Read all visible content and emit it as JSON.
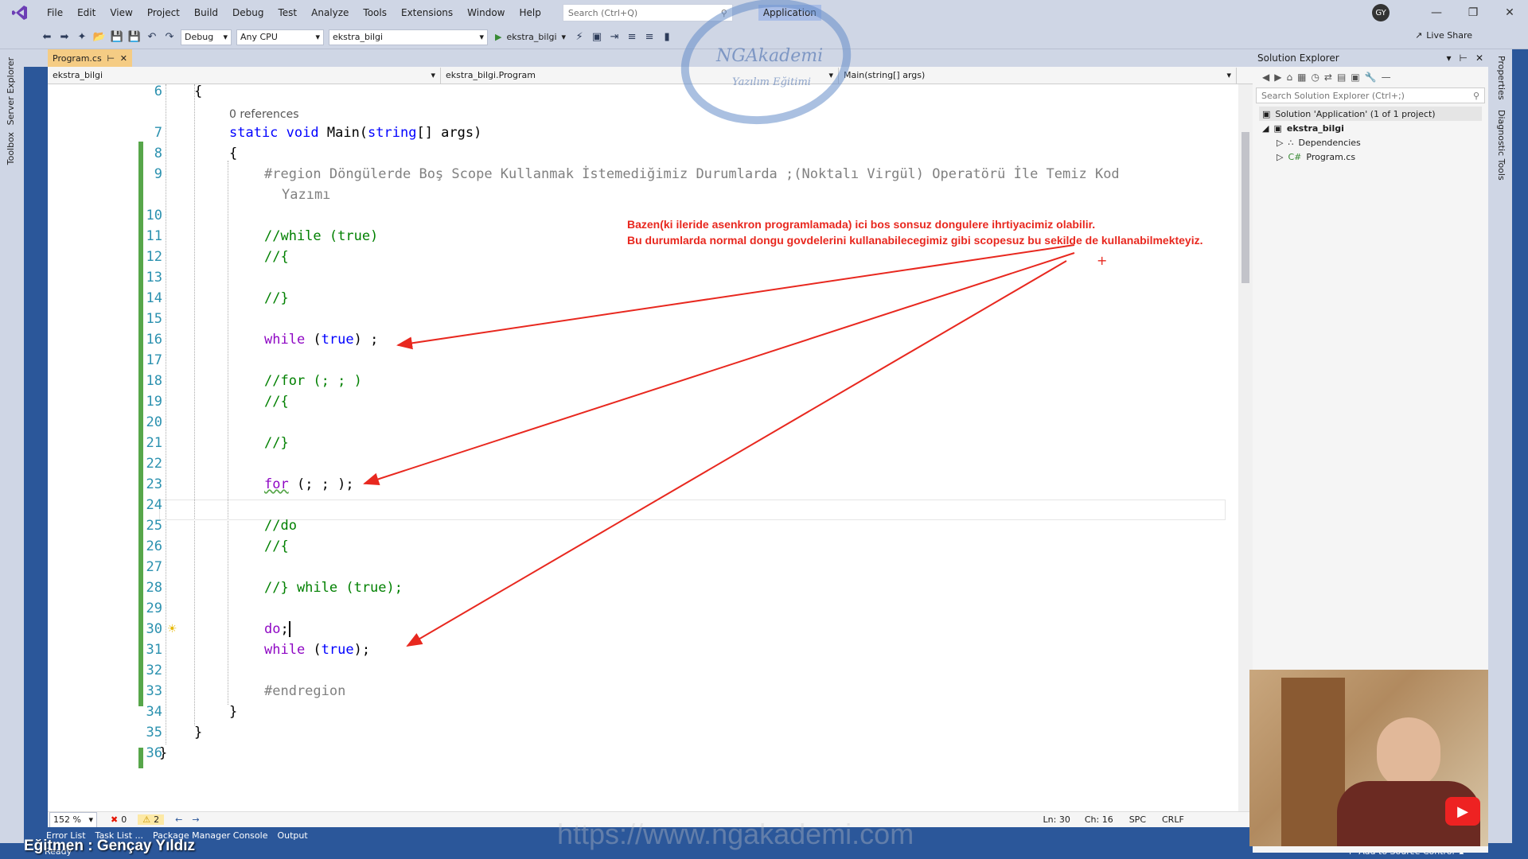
{
  "menu": {
    "items": [
      "File",
      "Edit",
      "View",
      "Project",
      "Build",
      "Debug",
      "Test",
      "Analyze",
      "Tools",
      "Extensions",
      "Window",
      "Help"
    ],
    "search_placeholder": "Search (Ctrl+Q)",
    "app_title": "Application",
    "avatar_initials": "GY"
  },
  "toolbar": {
    "config": "Debug",
    "platform": "Any CPU",
    "project": "ekstra_bilgi",
    "run_label": "ekstra_bilgi",
    "live_share": "Live Share"
  },
  "left_rail": {
    "server_explorer": "Server Explorer",
    "toolbox": "Toolbox"
  },
  "right_rail": {
    "properties": "Properties",
    "diagnostic": "Diagnostic Tools"
  },
  "doc_tab": {
    "name": "Program.cs"
  },
  "navbar": {
    "project": "ekstra_bilgi",
    "class": "ekstra_bilgi.Program",
    "member": "Main(string[] args)"
  },
  "editor": {
    "ref_hint": "0 references",
    "lines": [
      {
        "n": "6",
        "text": "{"
      },
      {
        "n": "7",
        "text": "static void Main(string[] args)"
      },
      {
        "n": "8",
        "text": "{"
      },
      {
        "n": "9",
        "text": "#region Döngülerde Boş Scope Kullanmak İstemediğimiz Durumlarda ;(Noktalı Virgül) Operatörü İle Temiz Kod"
      },
      {
        "n": "9b",
        "text": "Yazımı"
      },
      {
        "n": "10",
        "text": ""
      },
      {
        "n": "11",
        "text": "//while (true)"
      },
      {
        "n": "12",
        "text": "//{"
      },
      {
        "n": "13",
        "text": ""
      },
      {
        "n": "14",
        "text": "//}"
      },
      {
        "n": "15",
        "text": ""
      },
      {
        "n": "16",
        "text": "while (true) ;"
      },
      {
        "n": "17",
        "text": ""
      },
      {
        "n": "18",
        "text": "//for (; ; )"
      },
      {
        "n": "19",
        "text": "//{"
      },
      {
        "n": "20",
        "text": ""
      },
      {
        "n": "21",
        "text": "//}"
      },
      {
        "n": "22",
        "text": ""
      },
      {
        "n": "23",
        "text": "for (; ; );"
      },
      {
        "n": "24",
        "text": ""
      },
      {
        "n": "25",
        "text": "//do"
      },
      {
        "n": "26",
        "text": "//{"
      },
      {
        "n": "27",
        "text": ""
      },
      {
        "n": "28",
        "text": "//} while (true);"
      },
      {
        "n": "29",
        "text": ""
      },
      {
        "n": "30",
        "text": "do;"
      },
      {
        "n": "31",
        "text": "while (true);"
      },
      {
        "n": "32",
        "text": ""
      },
      {
        "n": "33",
        "text": "#endregion"
      },
      {
        "n": "34",
        "text": "}"
      },
      {
        "n": "35",
        "text": "}"
      },
      {
        "n": "36",
        "text": "}"
      }
    ],
    "annotation_line1": "Bazen(ki ileride asenkron programlamada) ici bos sonsuz dongulere ihrtiyacimiz olabilir.",
    "annotation_line2": "Bu durumlarda normal dongu govdelerini kullanabilecegimiz gibi scopesuz bu sekilde de kullanabilmekteyiz."
  },
  "editor_status": {
    "zoom": "152 %",
    "errors": "0",
    "warnings": "2",
    "ln": "Ln: 30",
    "ch": "Ch: 16",
    "spc": "SPC",
    "crlf": "CRLF"
  },
  "bottom_tabs": [
    "Error List",
    "Task List ...",
    "Package Manager Console",
    "Output"
  ],
  "statusbar": {
    "ready": "Ready",
    "source_control": "Add to Source Control"
  },
  "solution_explorer": {
    "title": "Solution Explorer",
    "search_placeholder": "Search Solution Explorer (Ctrl+;)",
    "tree": [
      {
        "label": "Solution 'Application' (1 of 1 project)"
      },
      {
        "label": "ekstra_bilgi"
      },
      {
        "label": "Dependencies"
      },
      {
        "label": "Program.cs"
      }
    ]
  },
  "overlay": {
    "instructor": "Eğitmen : Gençay Yıldız",
    "url": "https://www.ngakademi.com",
    "logo_name": "NGAkademi",
    "logo_sub": "Yazılım Eğitimi"
  },
  "colors": {
    "accent": "#2b579a",
    "annotation": "#e8281f",
    "tab_active": "#f5cc84",
    "change_bar": "#57a64a"
  }
}
